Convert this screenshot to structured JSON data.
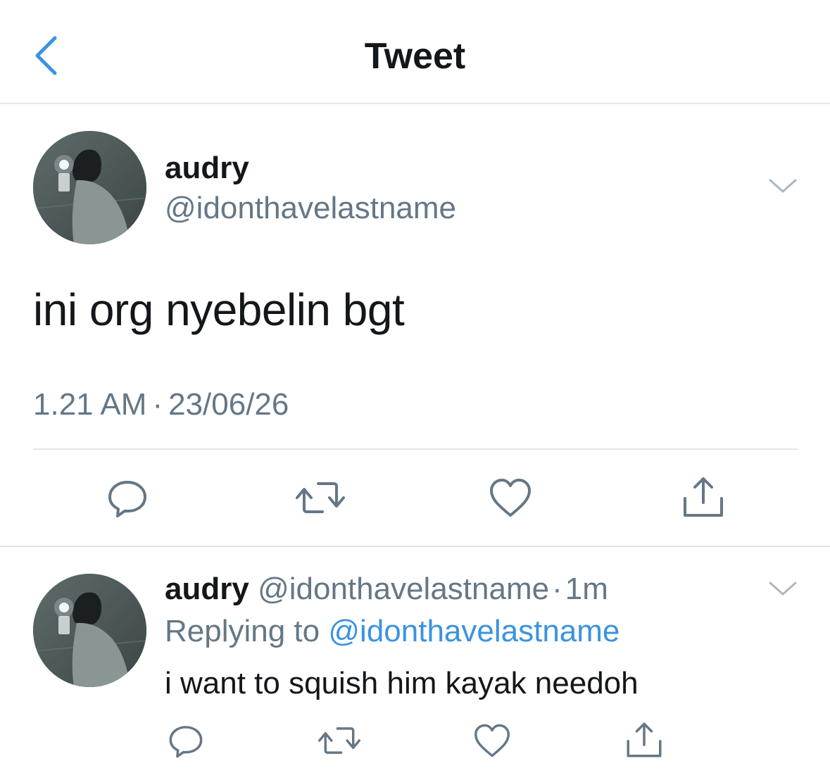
{
  "header": {
    "title": "Tweet",
    "back_icon": "chevron-left-icon"
  },
  "colors": {
    "accent": "#3b93e0",
    "text_primary": "#14171a",
    "text_secondary": "#657786",
    "divider": "#e1e8ed"
  },
  "main_tweet": {
    "display_name": "audry",
    "handle": "@idonthavelastname",
    "text": "ini org nyebelin bgt",
    "time": "1.21 AM",
    "separator": "·",
    "date": "23/06/26",
    "actions": [
      {
        "name": "reply",
        "icon": "comment-icon"
      },
      {
        "name": "retweet",
        "icon": "retweet-icon"
      },
      {
        "name": "like",
        "icon": "heart-icon"
      },
      {
        "name": "share",
        "icon": "share-icon"
      }
    ]
  },
  "reply_tweet": {
    "display_name": "audry",
    "handle": "@idonthavelastname",
    "separator": "·",
    "age": "1m",
    "replying_label": "Replying to",
    "replying_handle": "@idonthavelastname",
    "text": "i want to squish him kayak needoh"
  }
}
